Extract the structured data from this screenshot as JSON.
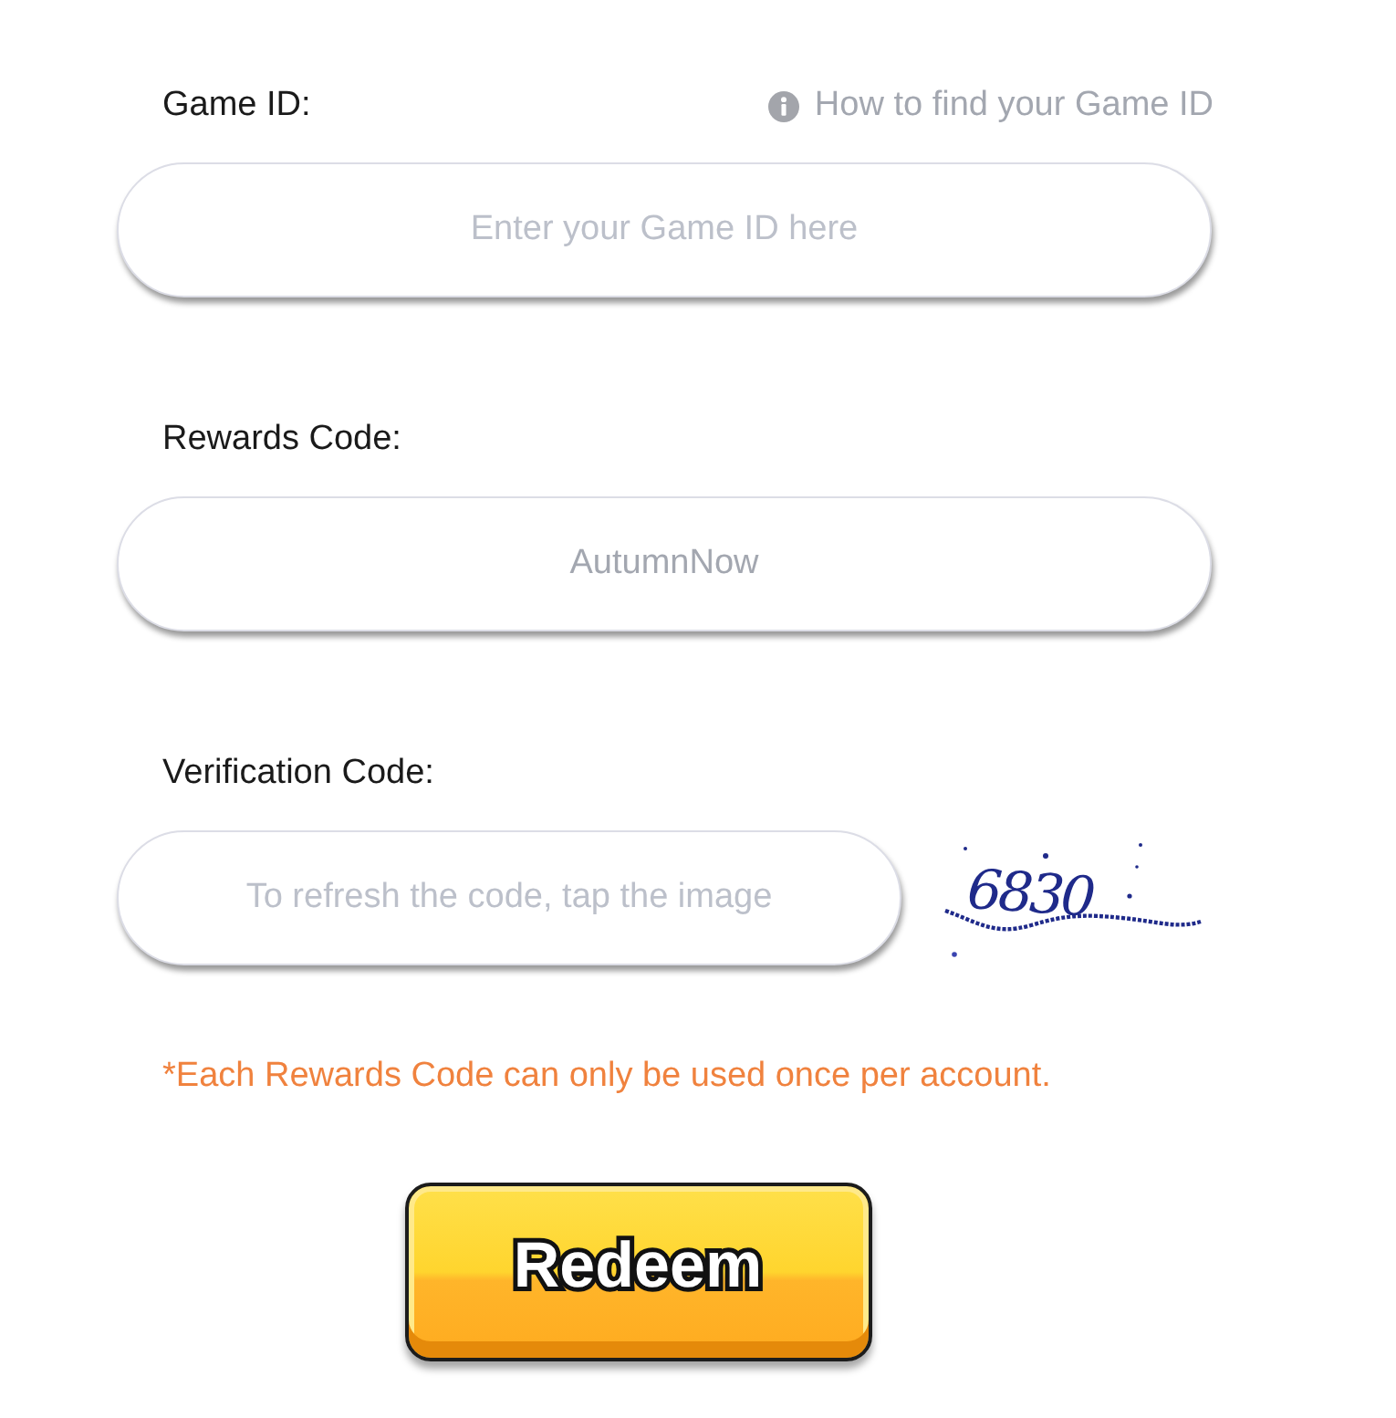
{
  "game_id": {
    "label": "Game ID:",
    "help_link": "How to find your Game ID",
    "placeholder": "Enter your Game ID here"
  },
  "rewards_code": {
    "label": "Rewards Code:",
    "value": "AutumnNow"
  },
  "verification_code": {
    "label": "Verification Code:",
    "placeholder": "To refresh the code, tap the image",
    "captcha": "6830"
  },
  "note": "*Each Rewards Code can only be used once per account.",
  "button": "Redeem"
}
